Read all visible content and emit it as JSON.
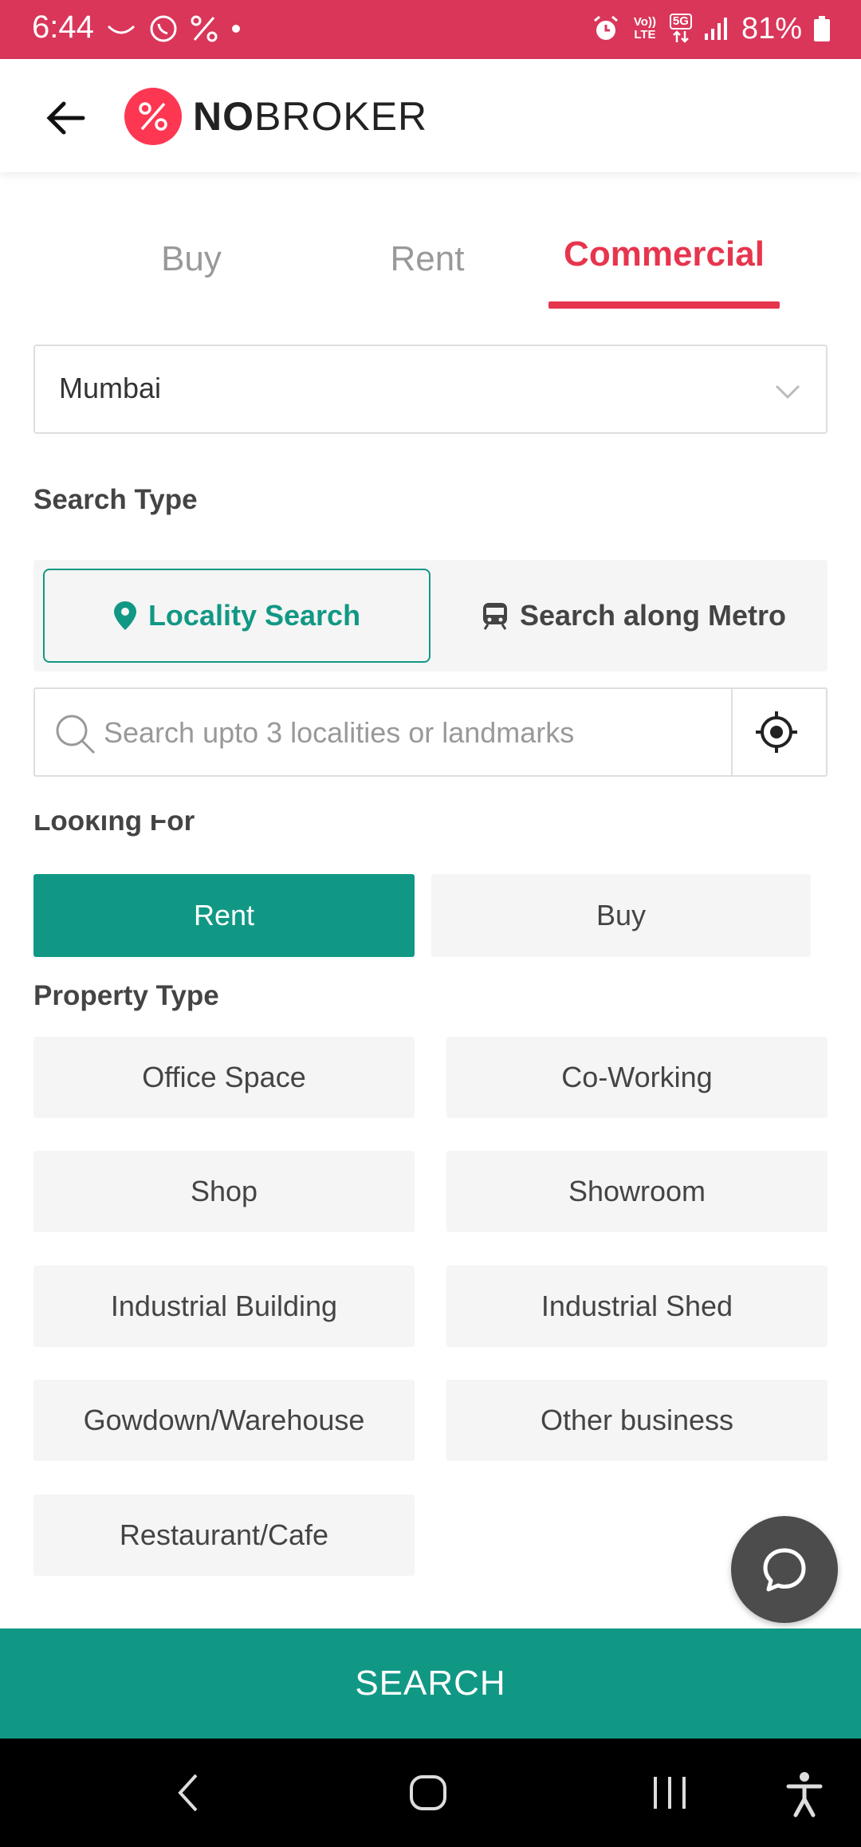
{
  "status_bar": {
    "time": "6:44",
    "battery": "81%",
    "volte_label": "Vo)) LTE",
    "network_label": "5G"
  },
  "header": {
    "logo_bold": "NO",
    "logo_rest": "BROKER"
  },
  "tabs": [
    {
      "label": "Buy",
      "active": false
    },
    {
      "label": "Rent",
      "active": false
    },
    {
      "label": "Commercial",
      "active": true
    }
  ],
  "city": {
    "selected": "Mumbai"
  },
  "search_type": {
    "label": "Search Type",
    "options": [
      {
        "label": "Locality Search",
        "selected": true
      },
      {
        "label": "Search along Metro",
        "selected": false
      }
    ]
  },
  "search": {
    "placeholder": "Search upto 3 localities or landmarks"
  },
  "looking_for": {
    "label": "Looking For",
    "options": [
      {
        "label": "Rent",
        "selected": true
      },
      {
        "label": "Buy",
        "selected": false
      }
    ]
  },
  "property_type": {
    "label": "Property Type",
    "options": [
      "Office Space",
      "Co-Working",
      "Shop",
      "Showroom",
      "Industrial Building",
      "Industrial Shed",
      "Gowdown/Warehouse",
      "Other business",
      "Restaurant/Cafe"
    ]
  },
  "search_button": "SEARCH",
  "colors": {
    "brand_red": "#e7354e",
    "status_bar": "#d9365a",
    "teal": "#119885"
  }
}
